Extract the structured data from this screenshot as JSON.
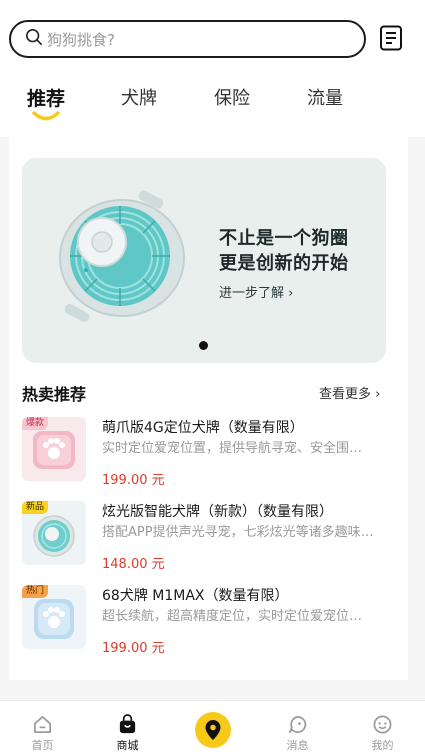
{
  "search": {
    "placeholder": "狗狗挑食?"
  },
  "tabs": [
    {
      "label": "推荐",
      "active": true
    },
    {
      "label": "犬牌",
      "active": false
    },
    {
      "label": "保险",
      "active": false
    },
    {
      "label": "流量",
      "active": false
    }
  ],
  "banner": {
    "line1": "不止是一个狗圈",
    "line2": "更是创新的开始",
    "link": "进一步了解 ›",
    "page_indicator": {
      "pages": 1,
      "current": 1
    }
  },
  "section": {
    "title": "热卖推荐",
    "more": "查看更多 ›"
  },
  "products": [
    {
      "badge": "爆款",
      "badge_color": "#f4c6d2",
      "name": "萌爪版4G定位犬牌（数量有限）",
      "desc": "实时定位爱宠位置，提供导航寻宠、安全围…",
      "price": "199.00 元"
    },
    {
      "badge": "新品",
      "badge_color": "#f8d21c",
      "name": "炫光版智能犬牌（新款）（数量有限）",
      "desc": "搭配APP提供声光寻宠，七彩炫光等诸多趣味…",
      "price": "148.00 元"
    },
    {
      "badge": "热门",
      "badge_color": "#f7a24a",
      "name": "68犬牌 M1MAX（数量有限）",
      "desc": "超长续航，超高精度定位，实时定位爱宠位…",
      "price": "199.00 元"
    }
  ],
  "nav": [
    {
      "label": "首页",
      "icon": "home-icon",
      "active": false
    },
    {
      "label": "商城",
      "icon": "shop-bag-icon",
      "active": true
    },
    {
      "label": "",
      "icon": "location-pin-icon",
      "active": false
    },
    {
      "label": "消息",
      "icon": "message-icon",
      "active": false
    },
    {
      "label": "我的",
      "icon": "profile-icon",
      "active": false
    }
  ],
  "colors": {
    "accent": "#f8c919",
    "price": "#e03a2a",
    "text_dark": "#111111",
    "text_muted": "#9a9a9a"
  }
}
